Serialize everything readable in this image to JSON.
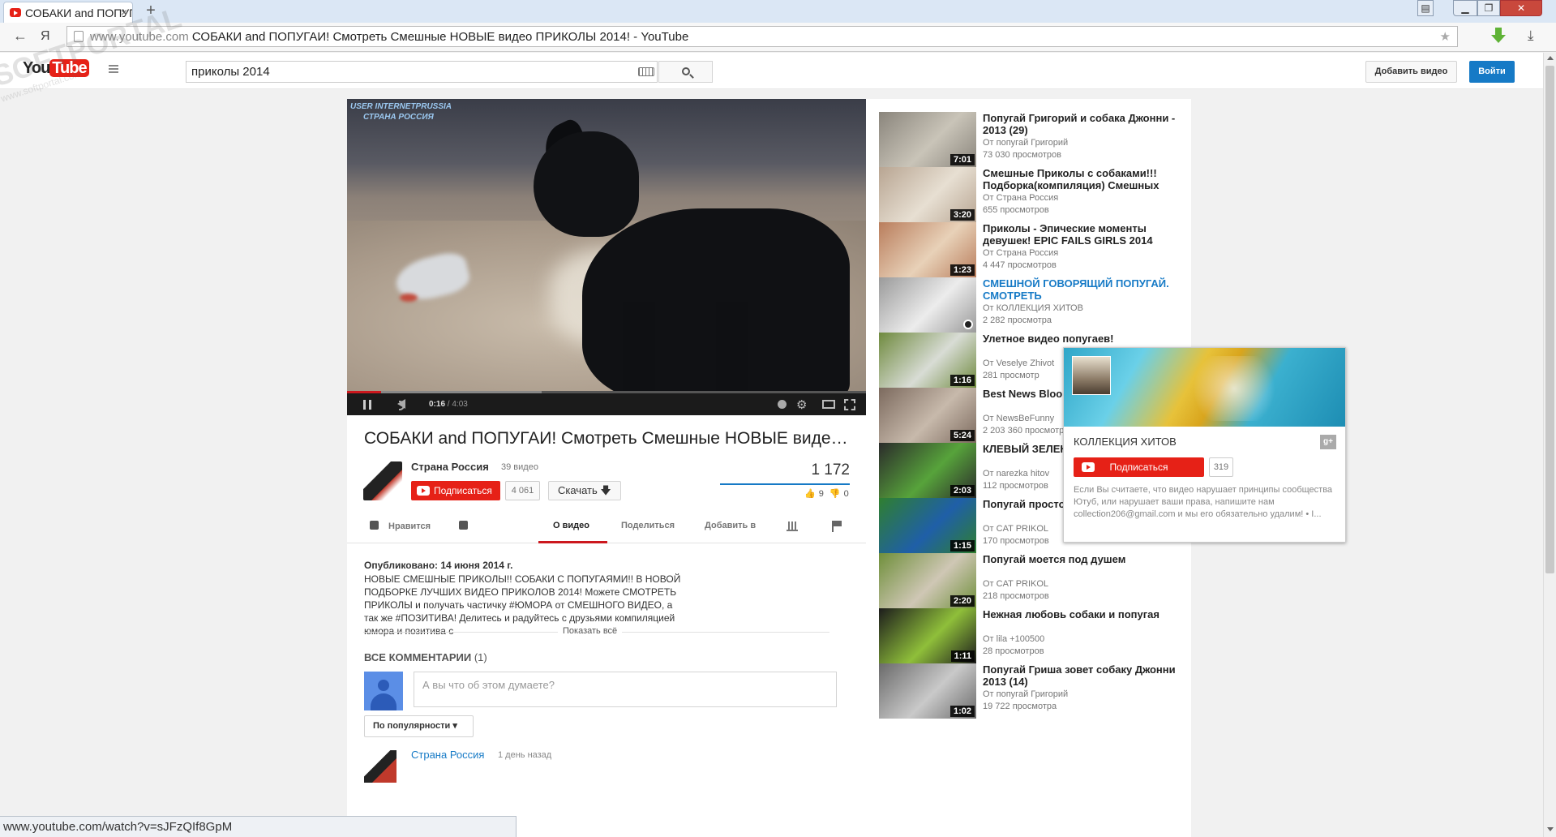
{
  "browser": {
    "tab_title": "СОБАКИ and ПОПУГ",
    "tab_close": "×",
    "new_tab": "+",
    "yandex_button": "Я",
    "url_host": "www.youtube.com",
    "page_title": "СОБАКИ and ПОПУГАИ! Смотреть Смешные НОВЫЕ видео ПРИКОЛЫ 2014! - YouTube",
    "status_url": "www.youtube.com/watch?v=sJFzQIf8GpM"
  },
  "watermark": {
    "title": "SOFTPORTAL",
    "subtitle": "www.softportal.com"
  },
  "masthead": {
    "logo_you": "You",
    "logo_tube": "Tube",
    "search_value": "приколы 2014",
    "upload_label": "Добавить видео",
    "signin_label": "Войти"
  },
  "player": {
    "overlay_line1": "USER INTERNETPRUSSIA",
    "overlay_line2": "СТРАНА РОССИЯ",
    "current_time": "0:16",
    "duration": " / 4:03",
    "progress_fraction": 0.066
  },
  "video": {
    "title": "СОБАКИ and ПОПУГАИ! Смотреть Смешные НОВЫЕ видео ПРИКОЛЫ 2014!",
    "channel": "Страна Россия",
    "video_count": "39 видео",
    "subscribe_label": "Подписаться",
    "subscriber_count": "4 061",
    "download_label": "Скачать 🡇",
    "views": "1 172",
    "likes": "9",
    "dislikes": "0",
    "like_fraction": 1.0
  },
  "actions": {
    "like_label": "Нравится",
    "tab_about": "О видео",
    "tab_share": "Поделиться",
    "tab_add": "Добавить в"
  },
  "description": {
    "published": "Опубликовано: 14 июня 2014 г.",
    "text": "НОВЫЕ СМЕШНЫЕ ПРИКОЛЫ!! СОБАКИ С ПОПУГАЯМИ!! В НОВОЙ ПОДБОРКЕ ЛУЧШИХ ВИДЕО ПРИКОЛОВ 2014! Можете СМОТРЕТЬ ПРИКОЛЫ и получать частичку #ЮМОРА от СМЕШНОГО ВИДЕО, а так же #ПОЗИТИВА! Делитесь и радуйтесь с друзьями компиляцией юмора и позитива с",
    "show_more": "Показать всё"
  },
  "comments": {
    "header": "ВСЕ КОММЕНТАРИИ",
    "count": "(1)",
    "placeholder": "А вы что об этом думаете?",
    "sort_label": "По популярности ▾",
    "first_author": "Страна Россия",
    "first_time": "1 день назад"
  },
  "related": [
    {
      "title": "Попугай Григорий и собака Джонни - 2013 (29)",
      "author": "От попугай Григорий",
      "views": "73 030 просмотров",
      "duration": "7:01",
      "colors": [
        "#8a857c",
        "#c9c4b8"
      ]
    },
    {
      "title": "Смешные Приколы с собаками!!! Подборка(компиляция) Смешных",
      "author": "От Страна Россия",
      "views": "655 просмотров",
      "duration": "3:20",
      "colors": [
        "#b8a592",
        "#e7dfd2"
      ]
    },
    {
      "title": "Приколы - Эпические моменты девушек! EPIC FAILS GIRLS 2014",
      "author": "От Страна Россия",
      "views": "4 447 просмотров",
      "duration": "1:23",
      "colors": [
        "#b97d5c",
        "#e8d1b8"
      ]
    },
    {
      "title": "СМЕШНОЙ ГОВОРЯЩИЙ ПОПУГАЙ. СМОТРЕТЬ",
      "author": "От КОЛЛЕКЦИЯ ХИТОВ",
      "views": "2 282 просмотра",
      "duration": "",
      "colors": [
        "#9a9a9a",
        "#ececec"
      ],
      "link": true
    },
    {
      "title": "Улетное видео попугаев!",
      "author": "От Veselye Zhivot",
      "views": "281 просмотр",
      "duration": "1:16",
      "colors": [
        "#6f8a3e",
        "#d8dcd5"
      ]
    },
    {
      "title": "Best News Bloo",
      "author": "От NewsBeFunny",
      "views": "2 203 360 просмотр",
      "duration": "5:24",
      "colors": [
        "#7c6a5e",
        "#c7b9ab"
      ]
    },
    {
      "title": "КЛЕВЫЙ ЗЕЛЕН СМОТРЕТЬ",
      "author": "От narezka hitov",
      "views": "112 просмотров",
      "duration": "2:03",
      "colors": [
        "#2b2b2b",
        "#57a33b"
      ]
    },
    {
      "title": "Попугай просто ржет",
      "author": "От CAT PRIKOL",
      "views": "170 просмотров",
      "duration": "1:15",
      "colors": [
        "#2f7f2f",
        "#1f5fa8"
      ]
    },
    {
      "title": "Попугай моется под душем",
      "author": "От CAT PRIKOL",
      "views": "218 просмотров",
      "duration": "2:20",
      "colors": [
        "#6f8f3a",
        "#cfc7b5"
      ]
    },
    {
      "title": "Нежная любовь собаки и попугая",
      "author": "От lila +100500",
      "views": "28 просмотров",
      "duration": "1:11",
      "colors": [
        "#1c1c1c",
        "#8fbf3a"
      ]
    },
    {
      "title": "Попугай Гриша зовет собаку Джонни 2013 (14)",
      "author": "От попугай Григорий",
      "views": "19 722 просмотра",
      "duration": "1:02",
      "colors": [
        "#6a6a6a",
        "#c9c9c9"
      ]
    }
  ],
  "hovercard": {
    "channel_name": "КОЛЛЕКЦИЯ ХИТОВ",
    "gplus": "g+",
    "subscribe_label": "Подписаться",
    "subscriber_count": "319",
    "text": "Если Вы считаете, что видео нарушает принципы сообщества Ютуб, или нарушает ваши права, напишите нам collection206@gmail.com и мы его обязательно удалим! • I..."
  },
  "colors": {
    "accent_red": "#e62117",
    "link_blue": "#167ac6",
    "progress_red": "#cc181e"
  }
}
